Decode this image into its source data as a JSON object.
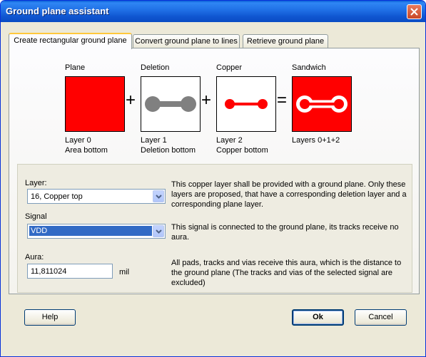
{
  "window": {
    "title": "Ground plane assistant"
  },
  "tabs": [
    {
      "label": "Create rectangular ground plane"
    },
    {
      "label": "Convert ground plane to lines"
    },
    {
      "label": "Retrieve ground plane"
    }
  ],
  "diagram": {
    "plane": {
      "label": "Plane",
      "caption1": "Layer 0",
      "caption2": "Area bottom"
    },
    "deletion": {
      "label": "Deletion",
      "caption1": "Layer 1",
      "caption2": "Deletion bottom"
    },
    "copper": {
      "label": "Copper",
      "caption1": "Layer 2",
      "caption2": "Copper bottom"
    },
    "sandwich": {
      "label": "Sandwich",
      "caption1": "Layers 0+1+2"
    },
    "plus": "+",
    "equals": "="
  },
  "form": {
    "layer_label": "Layer:",
    "layer_value": "16, Copper top",
    "layer_desc": "This copper layer shall be provided with a ground plane. Only these layers are proposed, that have a corresponding deletion layer and a corresponding plane layer.",
    "signal_label": "Signal",
    "signal_value": "VDD",
    "signal_desc": "This signal is connected to the ground plane, its tracks receive no aura.",
    "aura_label": "Aura:",
    "aura_value": "11,811024",
    "aura_unit": "mil",
    "aura_desc": "All pads, tracks and vias receive this aura, which is the distance to the ground plane (The tracks and vias of the selected signal are excluded)"
  },
  "buttons": {
    "help": "Help",
    "ok": "Ok",
    "cancel": "Cancel"
  },
  "colors": {
    "copper": "#ff0000",
    "deletion": "#808080",
    "title_bar": "#0a5fd6",
    "selection": "#316ac5"
  },
  "icons": [
    "close-icon",
    "plus-sign",
    "equals-sign",
    "dropdown-arrow-icon"
  ]
}
